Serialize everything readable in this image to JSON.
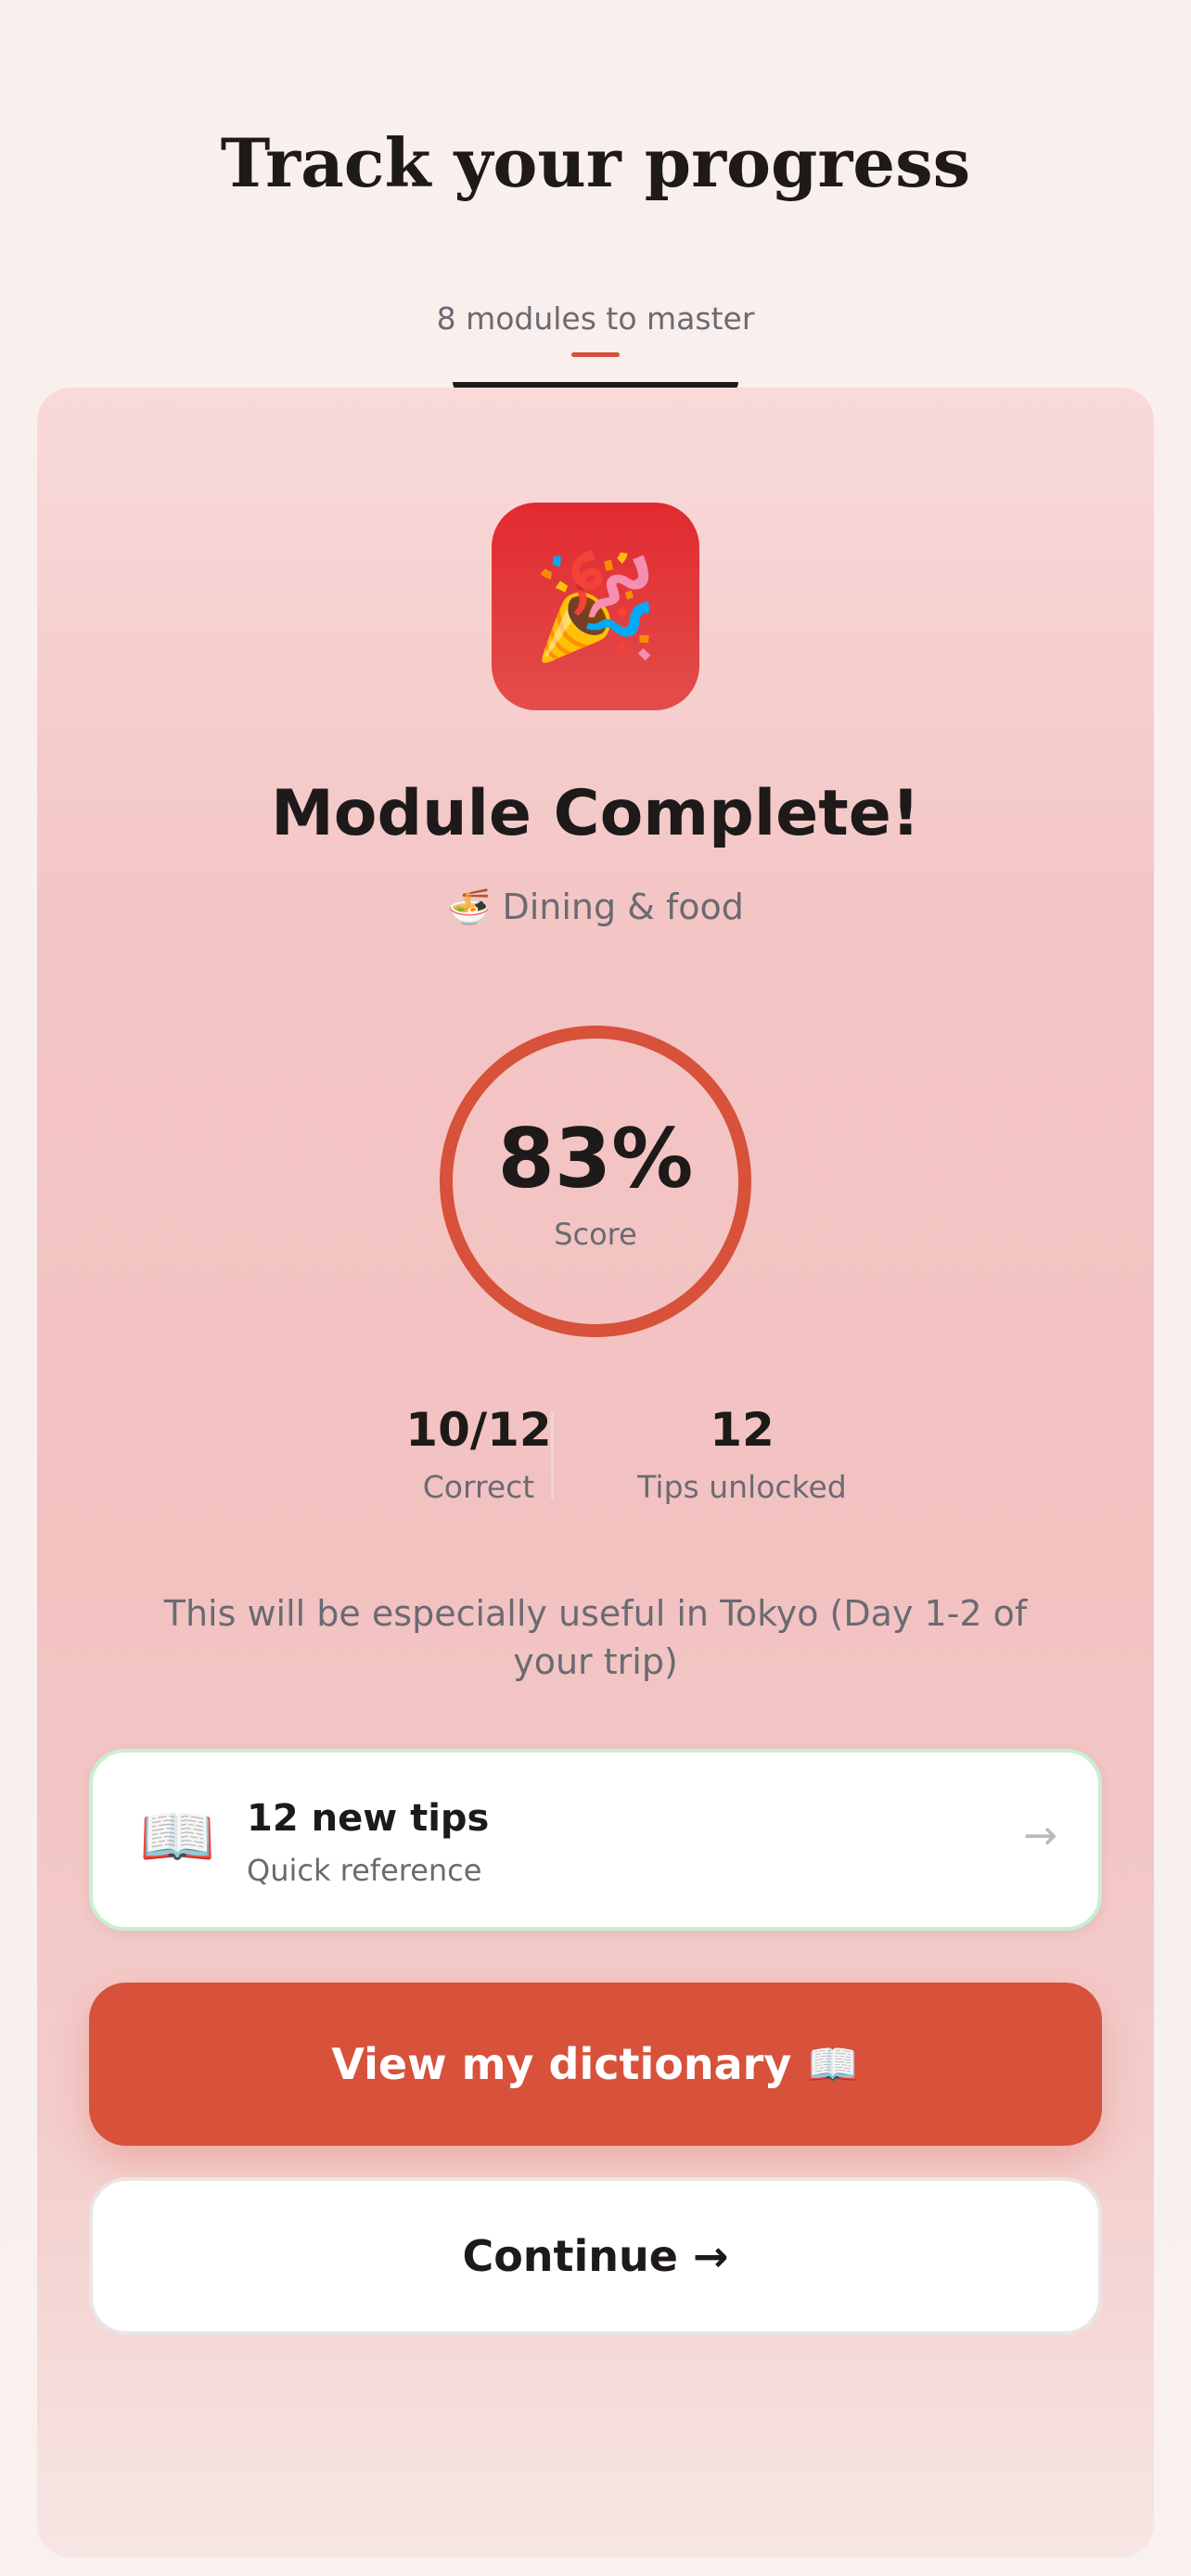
{
  "header": {
    "title": "Track your progress",
    "subtitle": "8 modules to master"
  },
  "result": {
    "badge_icon": "🎉",
    "title": "Module Complete!",
    "category": "🍜 Dining & food",
    "score": "83%",
    "score_label": "Score",
    "score_fraction": 0.83
  },
  "stats": {
    "correct_value": "10/12",
    "correct_label": "Correct",
    "tips_value": "12",
    "tips_label": "Tips unlocked"
  },
  "note": "This will be especially useful in Tokyo (Day 1-2 of your trip)",
  "tips_card": {
    "icon": "📖",
    "title": "12 new tips",
    "subtitle": "Quick reference",
    "arrow": "→"
  },
  "buttons": {
    "primary": "View my dictionary 📖",
    "secondary": "Continue →"
  },
  "colors": {
    "accent": "#d7513b",
    "badge": "#e12a2f",
    "tips_border": "#c9efd1"
  }
}
